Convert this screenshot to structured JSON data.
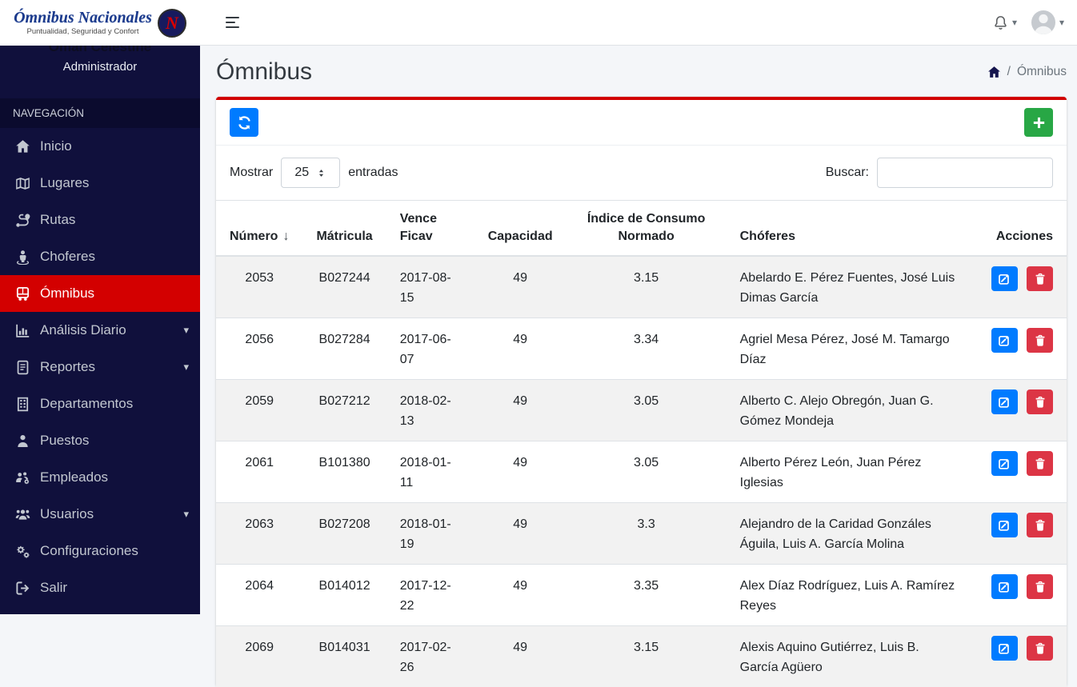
{
  "colors": {
    "sidebar_bg": "#10103c",
    "sidebar_active_red": "#d30000",
    "card_accent_red": "#d10000",
    "primary_blue": "#007bff",
    "success_green": "#28a745",
    "danger_red": "#dc3545",
    "content_bg": "#f4f6f9"
  },
  "icons": {
    "caret_down": "▾",
    "sort_asc": "↓"
  },
  "brand": {
    "title": "Ómnibus Nacionales",
    "subtitle": "Puntualidad, Seguridad y Confort",
    "badge_letter": "N"
  },
  "sidebar": {
    "user": {
      "name": "Oman Celestine",
      "role": "Administrador"
    },
    "section_label": "NAVEGACIÓN",
    "items": [
      {
        "label": "Inicio",
        "icon": "home-icon",
        "active": false,
        "caret": false
      },
      {
        "label": "Lugares",
        "icon": "map-icon",
        "active": false,
        "caret": false
      },
      {
        "label": "Rutas",
        "icon": "route-icon",
        "active": false,
        "caret": false
      },
      {
        "label": "Choferes",
        "icon": "driver-icon",
        "active": false,
        "caret": false
      },
      {
        "label": "Ómnibus",
        "icon": "bus-icon",
        "active": true,
        "caret": false
      },
      {
        "label": "Análisis Diario",
        "icon": "chart-bar-icon",
        "active": false,
        "caret": true
      },
      {
        "label": "Reportes",
        "icon": "file-report-icon",
        "active": false,
        "caret": true
      },
      {
        "label": "Departamentos",
        "icon": "building-icon",
        "active": false,
        "caret": false
      },
      {
        "label": "Puestos",
        "icon": "person-icon",
        "active": false,
        "caret": false
      },
      {
        "label": "Empleados",
        "icon": "employees-icon",
        "active": false,
        "caret": false
      },
      {
        "label": "Usuarios",
        "icon": "users-icon",
        "active": false,
        "caret": true
      },
      {
        "label": "Configuraciones",
        "icon": "gears-icon",
        "active": false,
        "caret": false
      },
      {
        "label": "Salir",
        "icon": "sign-out-icon",
        "active": false,
        "caret": false
      }
    ]
  },
  "page": {
    "title": "Ómnibus",
    "breadcrumb_current": "Ómnibus"
  },
  "controls": {
    "show_label": "Mostrar",
    "page_size": "25",
    "entries_label": "entradas",
    "search_label": "Buscar:",
    "search_value": ""
  },
  "table": {
    "columns": [
      {
        "key": "numero",
        "label": "Número",
        "sorted": "asc"
      },
      {
        "key": "matricula",
        "label": "Mátricula"
      },
      {
        "key": "vence_ficav",
        "label": "Vence Ficav"
      },
      {
        "key": "capacidad",
        "label": "Capacidad"
      },
      {
        "key": "indice",
        "label": "Índice de Consumo Normado"
      },
      {
        "key": "choferes",
        "label": "Chóferes"
      },
      {
        "key": "acciones",
        "label": "Acciones"
      }
    ],
    "rows": [
      {
        "numero": "2053",
        "matricula": "B027244",
        "vence_ficav": "2017-08-15",
        "capacidad": "49",
        "indice": "3.15",
        "choferes": "Abelardo E. Pérez Fuentes, José Luis Dimas García"
      },
      {
        "numero": "2056",
        "matricula": "B027284",
        "vence_ficav": "2017-06-07",
        "capacidad": "49",
        "indice": "3.34",
        "choferes": "Agriel Mesa Pérez, José M. Tamargo Díaz"
      },
      {
        "numero": "2059",
        "matricula": "B027212",
        "vence_ficav": "2018-02-13",
        "capacidad": "49",
        "indice": "3.05",
        "choferes": "Alberto C. Alejo Obregón, Juan G. Gómez Mondeja"
      },
      {
        "numero": "2061",
        "matricula": "B101380",
        "vence_ficav": "2018-01-11",
        "capacidad": "49",
        "indice": "3.05",
        "choferes": "Alberto Pérez León, Juan Pérez Iglesias"
      },
      {
        "numero": "2063",
        "matricula": "B027208",
        "vence_ficav": "2018-01-19",
        "capacidad": "49",
        "indice": "3.3",
        "choferes": "Alejandro de la Caridad Gonzáles Águila, Luis A. García Molina"
      },
      {
        "numero": "2064",
        "matricula": "B014012",
        "vence_ficav": "2017-12-22",
        "capacidad": "49",
        "indice": "3.35",
        "choferes": "Alex Díaz Rodríguez, Luis A. Ramírez Reyes"
      },
      {
        "numero": "2069",
        "matricula": "B014031",
        "vence_ficav": "2017-02-26",
        "capacidad": "49",
        "indice": "3.15",
        "choferes": "Alexis Aquino Gutiérrez, Luis B. García Agüero"
      }
    ]
  }
}
